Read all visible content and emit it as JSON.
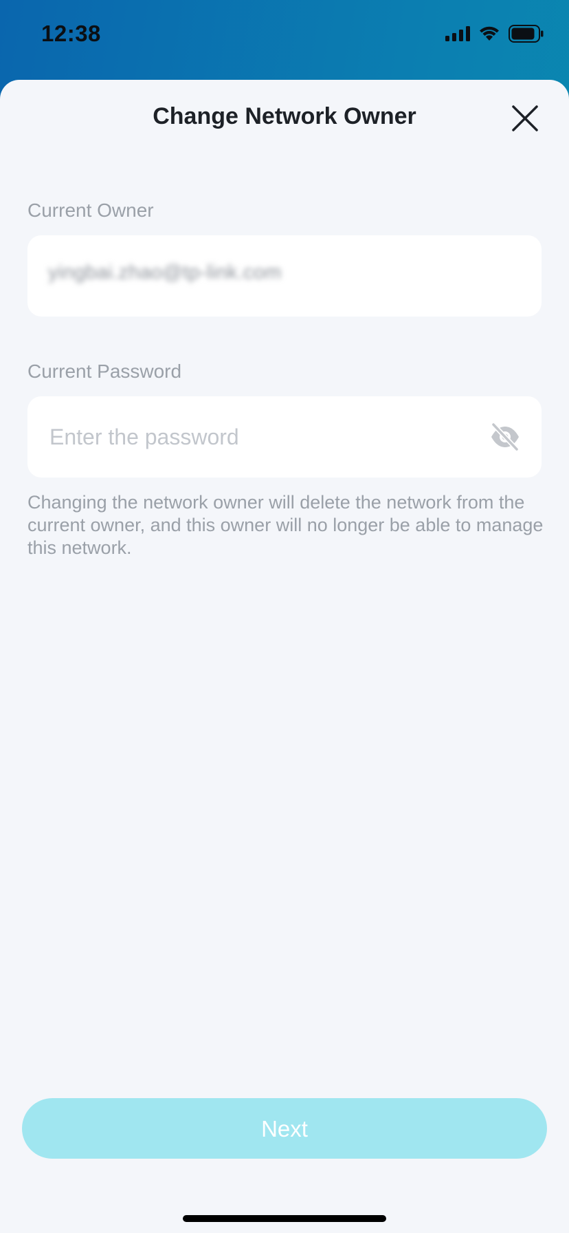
{
  "status_bar": {
    "time": "12:38",
    "icons": [
      "cellular-signal-icon",
      "wifi-icon",
      "battery-icon"
    ]
  },
  "sheet": {
    "title": "Change Network Owner",
    "close_icon": "close-icon"
  },
  "current_owner": {
    "label": "Current Owner",
    "value": "yingbai.zhao@tp-link.com"
  },
  "current_password": {
    "label": "Current Password",
    "placeholder": "Enter the password",
    "value": "",
    "visibility_icon": "eye-off-icon"
  },
  "hint": "Changing the network owner will delete the network from the current owner, and this owner will no longer be able to manage this network.",
  "next_button": {
    "label": "Next",
    "enabled": false
  },
  "colors": {
    "header_gradient_start": "#0a66ae",
    "header_gradient_end": "#0a8fb0",
    "sheet_background": "#f4f6fa",
    "button_disabled": "#a0e6f0",
    "label_gray": "#9aa0a8"
  }
}
